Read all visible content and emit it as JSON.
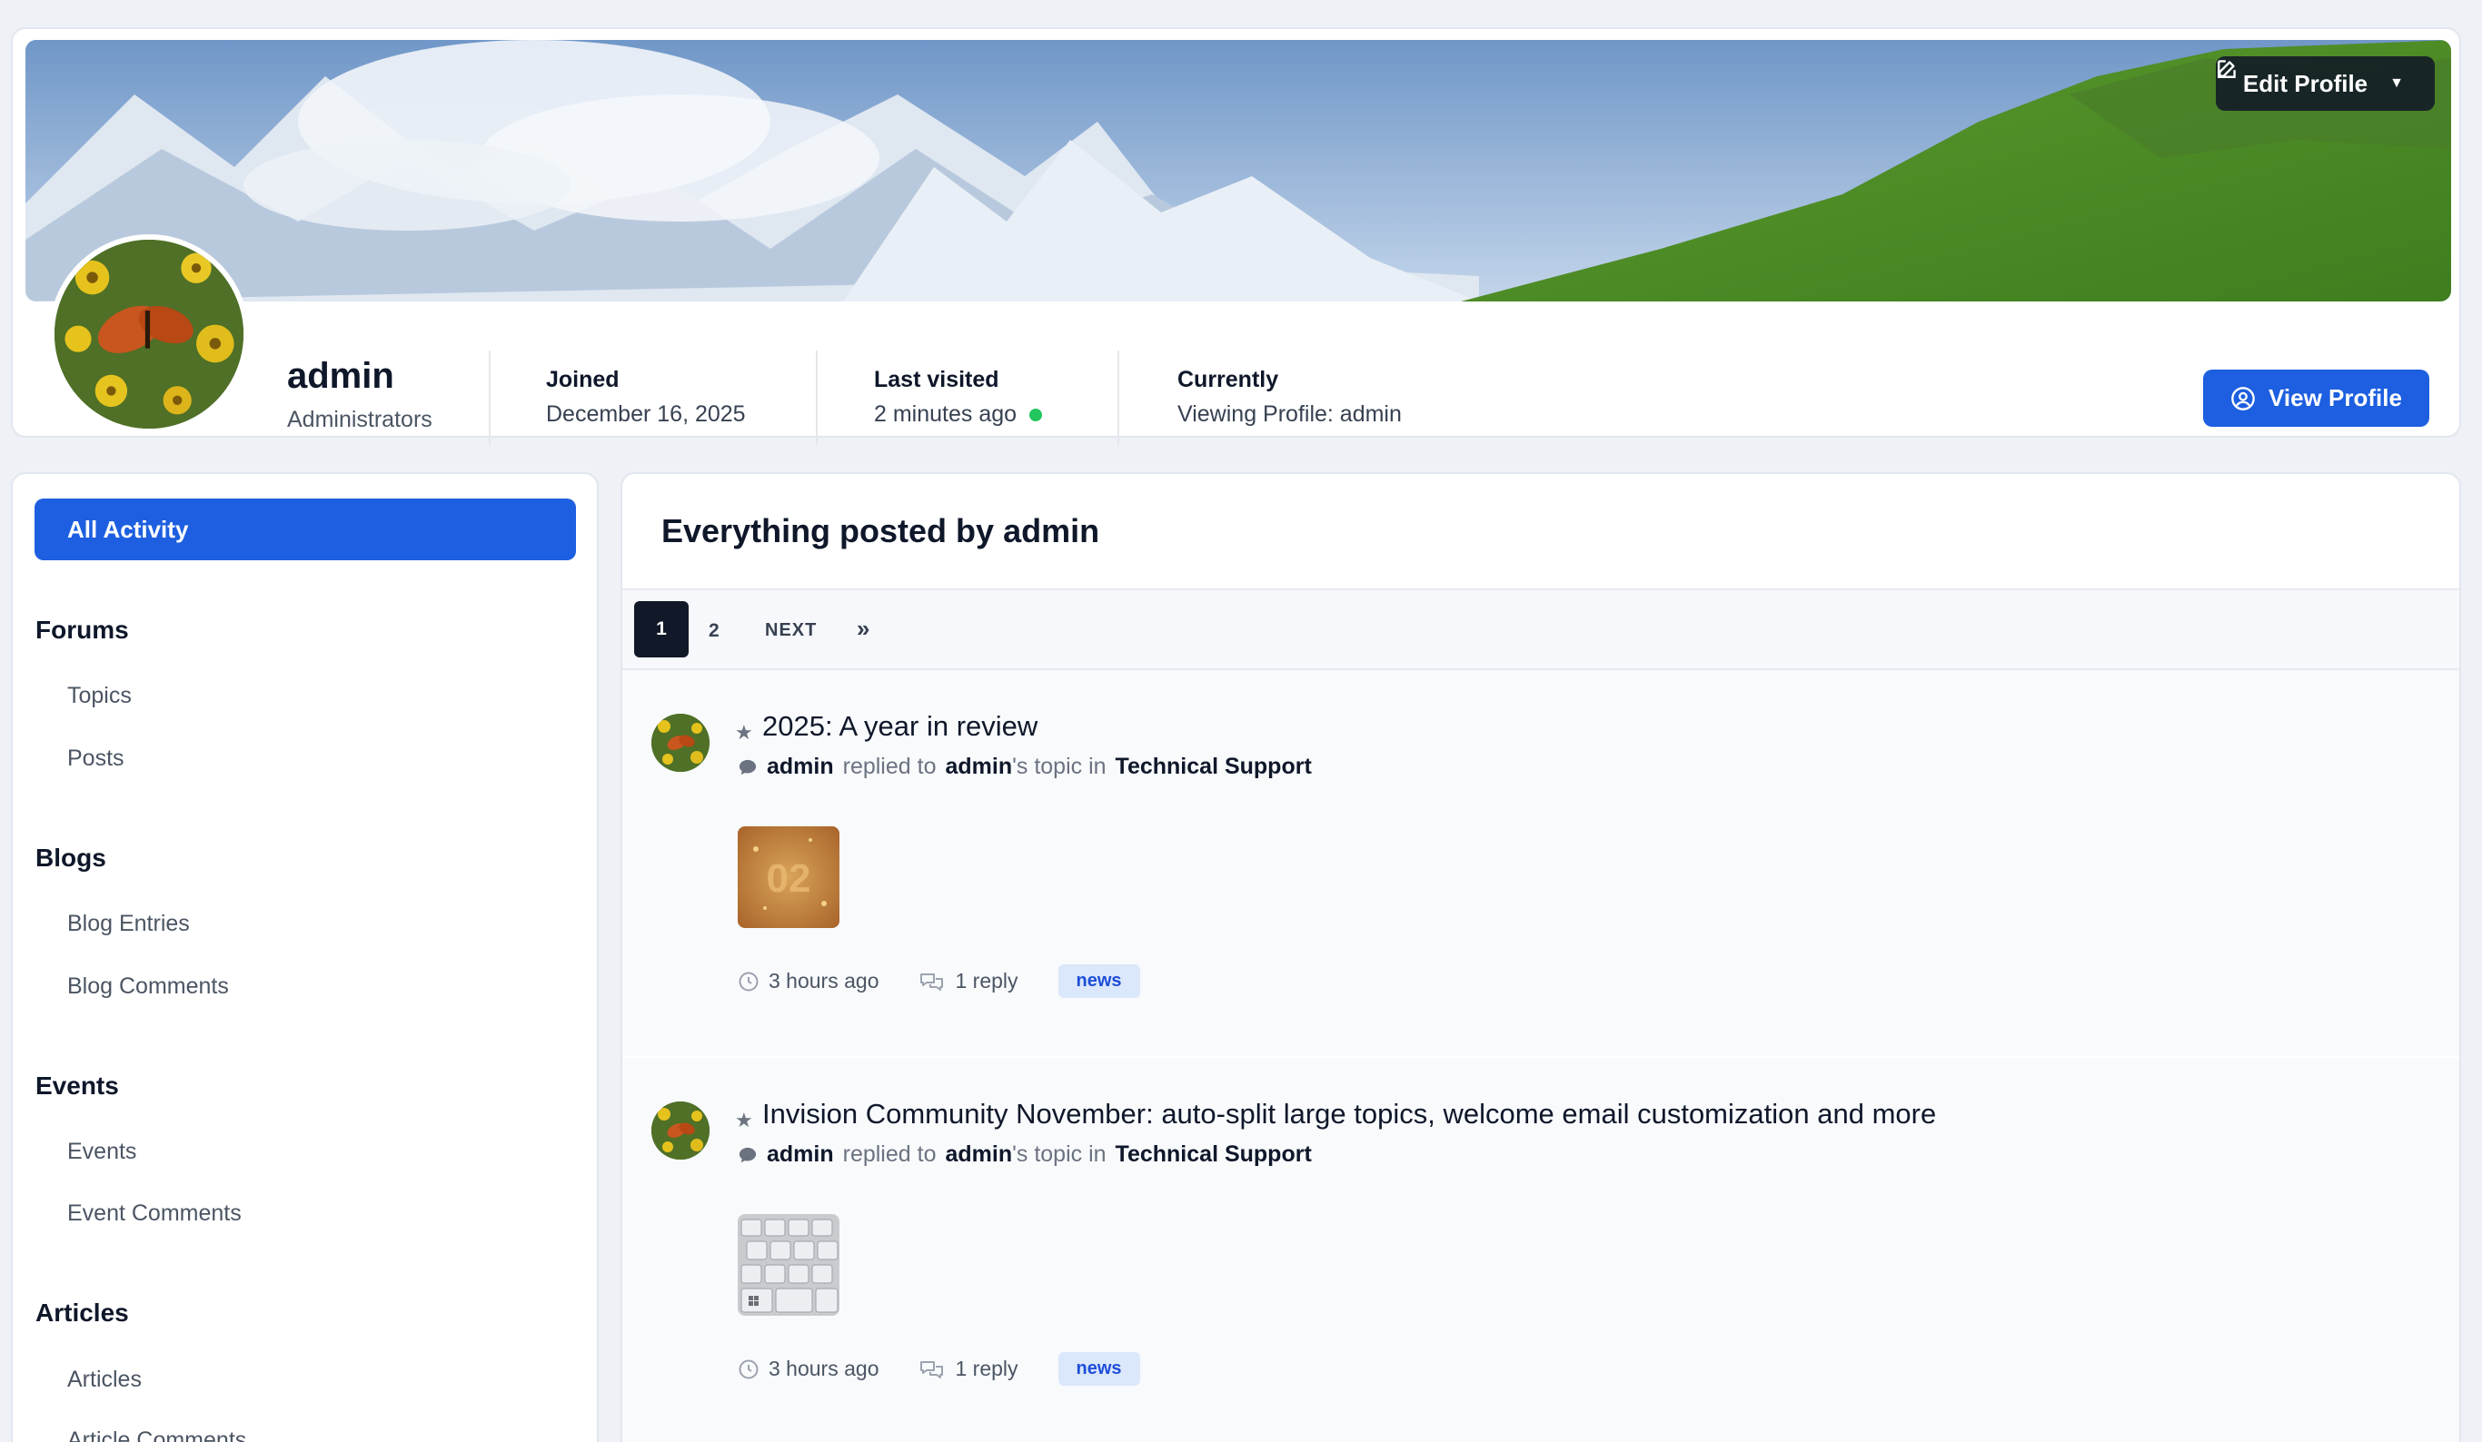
{
  "profile": {
    "edit_button": "Edit Profile",
    "name": "admin",
    "group": "Administrators",
    "joined_label": "Joined",
    "joined_value": "December 16, 2025",
    "last_visited_label": "Last visited",
    "last_visited_value": "2 minutes ago",
    "currently_label": "Currently",
    "currently_value": "Viewing Profile: admin",
    "view_button": "View Profile",
    "online_color": "#22c55e"
  },
  "sidebar": {
    "all_activity": "All Activity",
    "sections": [
      {
        "heading": "Forums",
        "links": [
          "Topics",
          "Posts"
        ]
      },
      {
        "heading": "Blogs",
        "links": [
          "Blog Entries",
          "Blog Comments"
        ]
      },
      {
        "heading": "Events",
        "links": [
          "Events",
          "Event Comments"
        ]
      },
      {
        "heading": "Articles",
        "links": [
          "Articles",
          "Article Comments"
        ]
      }
    ]
  },
  "main": {
    "title": "Everything posted by admin",
    "pagination": {
      "current": "1",
      "page2": "2",
      "next": "NEXT",
      "last_icon": "»"
    },
    "items": [
      {
        "title": "2025: A year in review",
        "author": "admin",
        "replied_to": "replied to",
        "topic_owner": "admin",
        "topic_suffix": "'s topic in",
        "forum": "Technical Support",
        "time": "3 hours ago",
        "replies": "1 reply",
        "tag": "news",
        "thumb_icon": "gold-02-thumbnail"
      },
      {
        "title": "Invision Community November: auto-split large topics, welcome email customization and more",
        "author": "admin",
        "replied_to": "replied to",
        "topic_owner": "admin",
        "topic_suffix": "'s topic in",
        "forum": "Technical Support",
        "time": "3 hours ago",
        "replies": "1 reply",
        "tag": "news",
        "thumb_icon": "keyboard-thumbnail"
      }
    ]
  },
  "colors": {
    "accent": "#1d5fe0",
    "tag_bg": "#dbe7fb",
    "tag_text": "#1d4ed8"
  }
}
